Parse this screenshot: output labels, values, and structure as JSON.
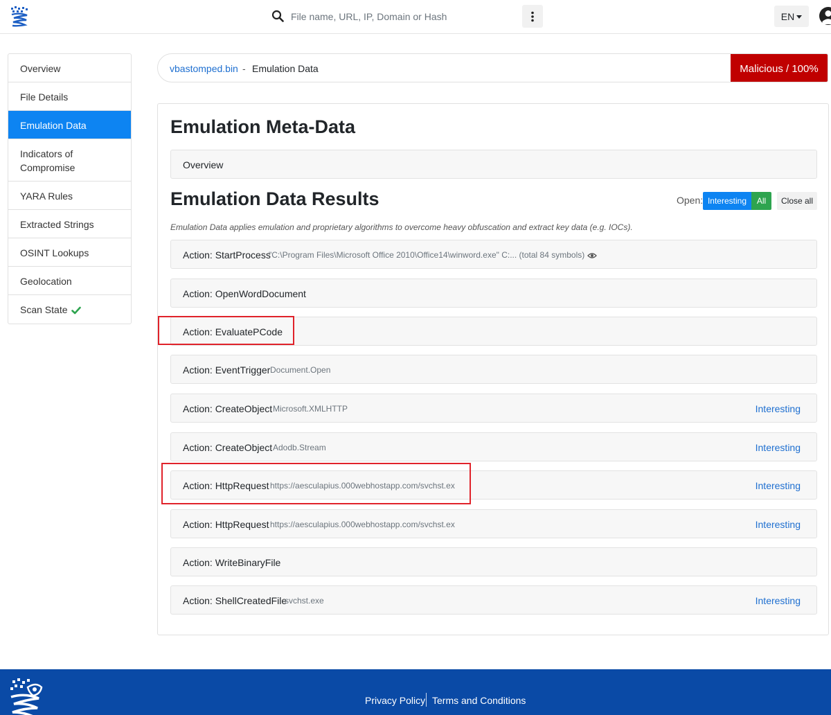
{
  "header": {
    "search_placeholder": "File name, URL, IP, Domain or Hash",
    "lang": "EN"
  },
  "sidebar": {
    "items": [
      {
        "label": "Overview"
      },
      {
        "label": "File Details"
      },
      {
        "label": "Emulation Data",
        "active": true
      },
      {
        "label": "Indicators of Compromise"
      },
      {
        "label": "YARA Rules"
      },
      {
        "label": "Extracted Strings"
      },
      {
        "label": "OSINT Lookups"
      },
      {
        "label": "Geolocation"
      },
      {
        "label": "Scan State"
      }
    ]
  },
  "breadcrumb": {
    "file": "vbastomped.bin",
    "separator": "-",
    "page": "Emulation Data",
    "verdict": "Malicious / 100%"
  },
  "main": {
    "meta_title": "Emulation Meta-Data",
    "overview_label": "Overview",
    "results_title": "Emulation Data Results",
    "open_label": "Open:",
    "btn_interesting": "Interesting",
    "btn_all": "All",
    "btn_close_all": "Close all",
    "description": "Emulation Data applies emulation and proprietary algorithms to overcome heavy obfuscation and extract key data (e.g. IOCs).",
    "actions": [
      {
        "label": "Action: StartProcess",
        "detail": "\"C:\\Program Files\\Microsoft Office 2010\\Office14\\winword.exe\" C:... (total 84 symbols)",
        "tag": ""
      },
      {
        "label": "Action: OpenWordDocument",
        "detail": "",
        "tag": ""
      },
      {
        "label": "Action: EvaluatePCode",
        "detail": "",
        "tag": ""
      },
      {
        "label": "Action: EventTrigger",
        "detail": "Document.Open",
        "tag": ""
      },
      {
        "label": "Action: CreateObject",
        "detail": "Microsoft.XMLHTTP",
        "tag": "Interesting"
      },
      {
        "label": "Action: CreateObject",
        "detail": "Adodb.Stream",
        "tag": "Interesting"
      },
      {
        "label": "Action: HttpRequest",
        "detail": "https://aesculapius.000webhostapp.com/svchst.ex",
        "tag": "Interesting"
      },
      {
        "label": "Action: HttpRequest",
        "detail": "https://aesculapius.000webhostapp.com/svchst.ex",
        "tag": "Interesting"
      },
      {
        "label": "Action: WriteBinaryFile",
        "detail": "",
        "tag": ""
      },
      {
        "label": "Action: ShellCreatedFile",
        "detail": "svchst.exe",
        "tag": "Interesting"
      }
    ]
  },
  "footer": {
    "privacy": "Privacy Policy",
    "terms": "Terms and Conditions"
  },
  "colors": {
    "accent": "#0d84f2",
    "verdict": "#c00000",
    "footer": "#0a4aa6",
    "success": "#2ea44f",
    "highlight": "#e0222a"
  }
}
